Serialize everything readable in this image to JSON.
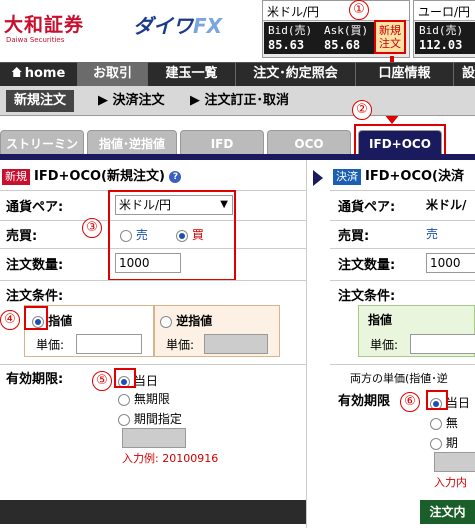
{
  "header": {
    "logo_daiwa": "大和証券",
    "logo_daiwa_sub": "Daiwa Securities",
    "logo_fx_prefix": "ダイワ",
    "logo_fx_suffix": "FX",
    "quote1": {
      "pair": "米ドル/円",
      "bid_label": "Bid(売)",
      "ask_label": "Ask(買)",
      "bid": "85.63",
      "ask": "85.68"
    },
    "quote2": {
      "pair": "ユーロ/円",
      "bid_label": "Bid(売)",
      "bid": "112.03"
    },
    "new_order_btn": "新規注文"
  },
  "nav": {
    "items": [
      "home",
      "お取引",
      "建玉一覧",
      "注文･約定照会",
      "口座情報",
      "設"
    ]
  },
  "subnav": {
    "items": [
      "新規注文",
      "決済注文",
      "注文訂正･取消"
    ]
  },
  "tabs": [
    "ストリーミング",
    "指値･逆指値",
    "IFD",
    "OCO",
    "IFD+OCO"
  ],
  "annotations": [
    "①",
    "②",
    "③",
    "④",
    "⑤",
    "⑥"
  ],
  "left": {
    "badge": "新規",
    "title": "IFD+OCO(新規注文)",
    "pair_label": "通貨ペア:",
    "pair_value": "米ドル/円",
    "side_label": "売買:",
    "sell": "売",
    "buy": "買",
    "qty_label": "注文数量:",
    "qty_value": "1000",
    "cond_label": "注文条件:",
    "limit": "指値",
    "stop": "逆指値",
    "price_label": "単価:",
    "expiry_label": "有効期限:",
    "today": "当日",
    "unlimited": "無期限",
    "date_spec": "期間指定",
    "example": "入力例: 20100916"
  },
  "right": {
    "badge": "決済",
    "title": "IFD+OCO(決済",
    "pair_label": "通貨ペア:",
    "pair_value": "米ドル/",
    "side_label": "売買:",
    "sell": "売",
    "qty_label": "注文数量:",
    "qty_value": "1000",
    "cond_label": "注文条件:",
    "limit": "指値",
    "price_label": "単価:",
    "both_note": "両方の単価(指値･逆",
    "expiry_label": "有効期限",
    "today": "当日",
    "unlimited": "無",
    "date_spec": "期",
    "example": "入力内",
    "confirm": "注文内"
  }
}
